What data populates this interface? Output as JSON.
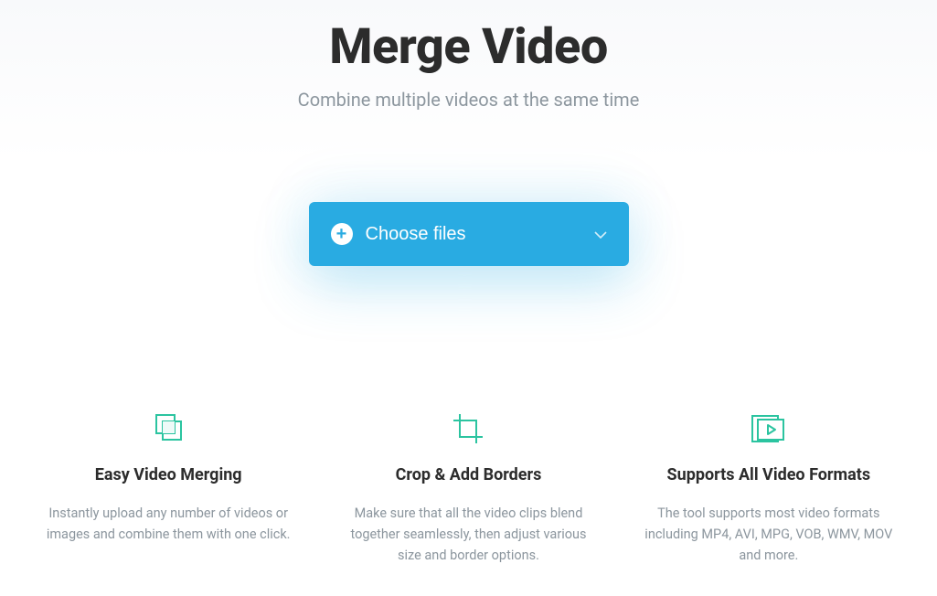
{
  "hero": {
    "title": "Merge Video",
    "subtitle": "Combine multiple videos at the same time",
    "choose_label": "Choose files"
  },
  "features": [
    {
      "title": "Easy Video Merging",
      "desc": "Instantly upload any number of videos or images and combine them with one click."
    },
    {
      "title": "Crop & Add Borders",
      "desc": "Make sure that all the video clips blend together seamlessly, then adjust various size and border options."
    },
    {
      "title": "Supports All Video Formats",
      "desc": "The tool supports most video formats including MP4, AVI, MPG, VOB, WMV, MOV and more."
    }
  ]
}
